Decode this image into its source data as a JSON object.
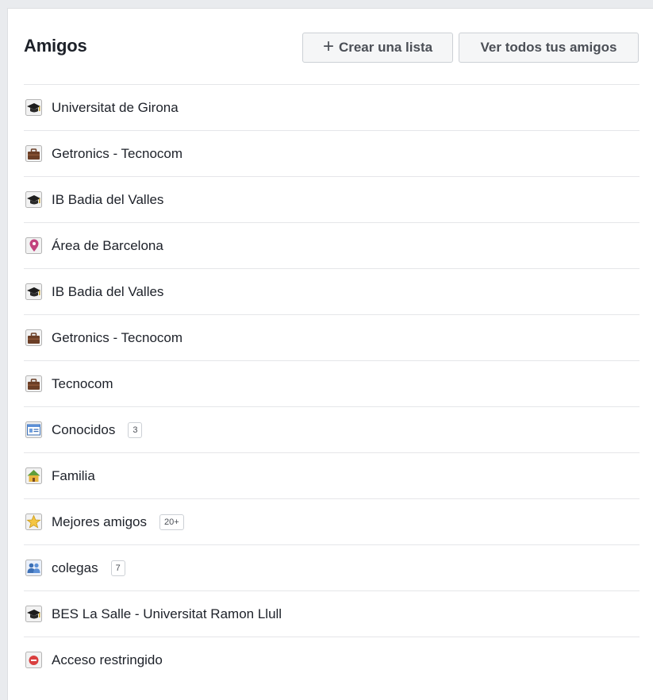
{
  "header": {
    "title": "Amigos",
    "create_list_label": "Crear una lista",
    "create_list_plus": "+",
    "see_all_label": "Ver todos tus amigos"
  },
  "lists": [
    {
      "label": "Universitat de Girona",
      "icon": "education-icon",
      "badge": null
    },
    {
      "label": "Getronics - Tecnocom",
      "icon": "work-icon",
      "badge": null
    },
    {
      "label": "IB Badia del Valles",
      "icon": "education-icon",
      "badge": null
    },
    {
      "label": "Área de Barcelona",
      "icon": "location-icon",
      "badge": null
    },
    {
      "label": "IB Badia del Valles",
      "icon": "education-icon",
      "badge": null
    },
    {
      "label": "Getronics - Tecnocom",
      "icon": "work-icon",
      "badge": null
    },
    {
      "label": "Tecnocom",
      "icon": "work-icon",
      "badge": null
    },
    {
      "label": "Conocidos",
      "icon": "acquaintances-icon",
      "badge": "3"
    },
    {
      "label": "Familia",
      "icon": "family-icon",
      "badge": null
    },
    {
      "label": "Mejores amigos",
      "icon": "star-icon",
      "badge": "20+"
    },
    {
      "label": "colegas",
      "icon": "people-icon",
      "badge": "7"
    },
    {
      "label": "BES La Salle - Universitat Ramon Llull",
      "icon": "education-icon",
      "badge": null
    },
    {
      "label": "Acceso restringido",
      "icon": "restricted-icon",
      "badge": null
    }
  ]
}
